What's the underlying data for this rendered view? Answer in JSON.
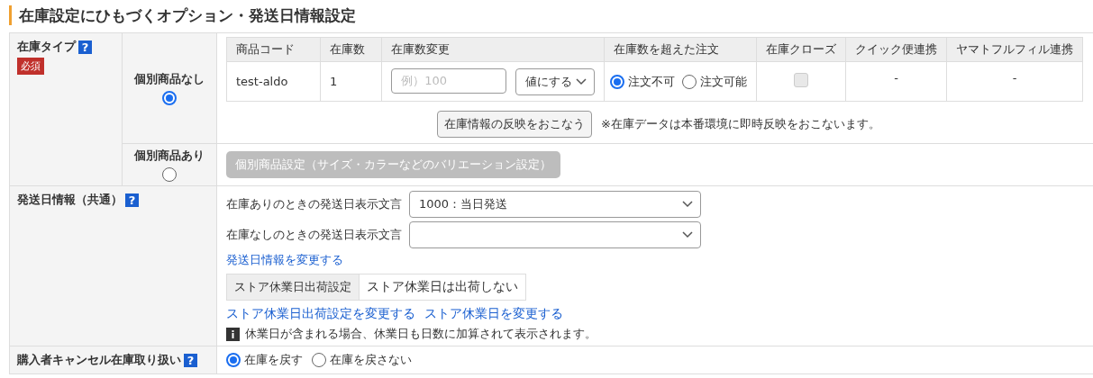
{
  "title": "在庫設定にひもづくオプション・発送日情報設定",
  "stock_type": {
    "label": "在庫タイプ",
    "help": "?",
    "badge": "必須",
    "options": [
      {
        "label": "個別商品なし",
        "selected": true
      },
      {
        "label": "個別商品あり",
        "selected": false
      }
    ],
    "table": {
      "columns": [
        "商品コード",
        "在庫数",
        "在庫数変更",
        "在庫数を超えた注文",
        "在庫クローズ",
        "クイック便連携",
        "ヤマトフルフィル連携"
      ],
      "rows": [
        {
          "code": "test-aldo",
          "count": "1",
          "change_placeholder": "例）100",
          "change_mode": "値にする",
          "order_options": [
            {
              "label": "注文不可",
              "selected": true
            },
            {
              "label": "注文可能",
              "selected": false
            }
          ],
          "close": {
            "checked": false,
            "disabled": true
          },
          "quick": "-",
          "yamato": "-"
        }
      ]
    },
    "apply_button": "在庫情報の反映をおこなう",
    "note": "※在庫データは本番環境に即時反映をおこないます。",
    "variation_button": {
      "label": "個別商品設定（サイズ・カラーなどのバリエーション設定）",
      "disabled": true
    }
  },
  "shipping": {
    "label": "発送日情報（共通）",
    "help": "?",
    "fields": [
      {
        "label": "在庫ありのときの発送日表示文言",
        "value": "1000：当日発送"
      },
      {
        "label": "在庫なしのときの発送日表示文言"
      }
    ],
    "link": "発送日情報を変更する",
    "holiday": {
      "label": "ストア休業日出荷設定",
      "value": "ストア休業日は出荷しない"
    },
    "links": [
      "ストア休業日出荷設定を変更する",
      "ストア休業日を変更する"
    ],
    "info": "休業日が含まれる場合、休業日も日数に加算されて表示されます。"
  },
  "cancel": {
    "label": "購入者キャンセル在庫取り扱い",
    "help": "?",
    "options": [
      {
        "label": "在庫を戻す",
        "selected": true
      },
      {
        "label": "在庫を戻さない",
        "selected": false
      }
    ]
  }
}
